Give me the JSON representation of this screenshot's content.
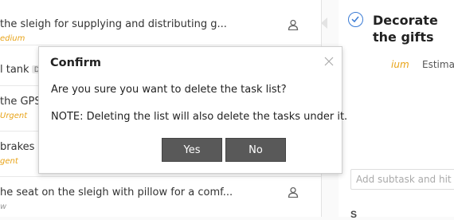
{
  "task_list": {
    "rows": [
      {
        "title": "the sleigh for supplying and distributing g...",
        "priority": "edium",
        "priority_color": "#e8a317"
      },
      {
        "title": "l tank",
        "tag": "D"
      },
      {
        "title": "the GPS r",
        "priority": "Urgent",
        "priority_color": "#e8a317"
      },
      {
        "title": "brakes c",
        "priority": "gent",
        "priority_color": "#e8a317"
      },
      {
        "title": "he seat on the sleigh with pillow for a comf...",
        "priority": "w",
        "priority_color": "#999999"
      }
    ]
  },
  "detail": {
    "title": "Decorate the gifts",
    "priority_label": "ium",
    "estimate_label": "Estimat",
    "subtask_placeholder": "Add subtask and hit en",
    "bottom_text": "S"
  },
  "dialog": {
    "title": "Confirm",
    "message": "Are you sure you want to delete the task list?",
    "note": "NOTE: Deleting the list will also delete the tasks under it.",
    "yes_label": "Yes",
    "no_label": "No"
  },
  "colors": {
    "accent": "#3a7bd5",
    "button_bg": "#595959",
    "priority_orange": "#e8a317"
  },
  "icons": {
    "assignee": "user-icon",
    "complete": "check-circle-icon",
    "close": "close-icon"
  }
}
